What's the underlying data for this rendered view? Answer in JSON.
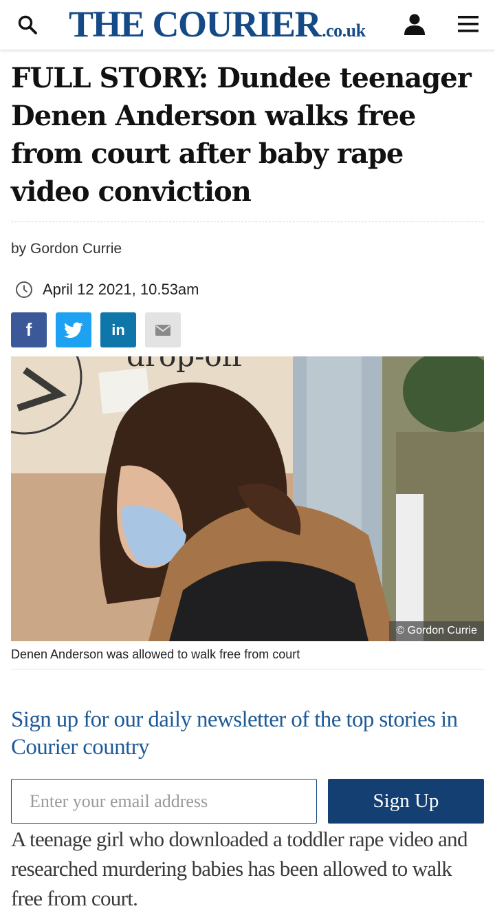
{
  "header": {
    "logo_main": "THE COURIER",
    "logo_tld": ".co.uk",
    "brand_color": "#154a87",
    "icons": [
      "search-icon",
      "user-icon",
      "menu-icon"
    ]
  },
  "article": {
    "headline": "FULL STORY: Dundee teenager Denen Anderson walks free from court after baby rape video conviction",
    "byline": "by Gordon Currie",
    "date": "April 12 2021, 10.53am",
    "share": {
      "facebook_label": "f",
      "twitter_icon": "twitter-bird-icon",
      "linkedin_label": "in",
      "email_icon": "mail-icon",
      "colors": {
        "facebook": "#3b5998",
        "twitter": "#1da1f2",
        "linkedin": "#0e76a8",
        "email": "#e3e3e3"
      }
    },
    "photo": {
      "signage_text": "drop-off",
      "credit": "© Gordon Currie",
      "caption": "Denen Anderson was allowed to walk free from court"
    },
    "lede": "A teenage girl who downloaded a toddler rape video and researched murdering babies has been allowed to walk free from court."
  },
  "newsletter": {
    "title": "Sign up for our daily newsletter of the top stories in Courier country",
    "email_placeholder": "Enter your email address",
    "button_label": "Sign Up",
    "button_color": "#133f73",
    "title_color": "#1e5a96"
  }
}
